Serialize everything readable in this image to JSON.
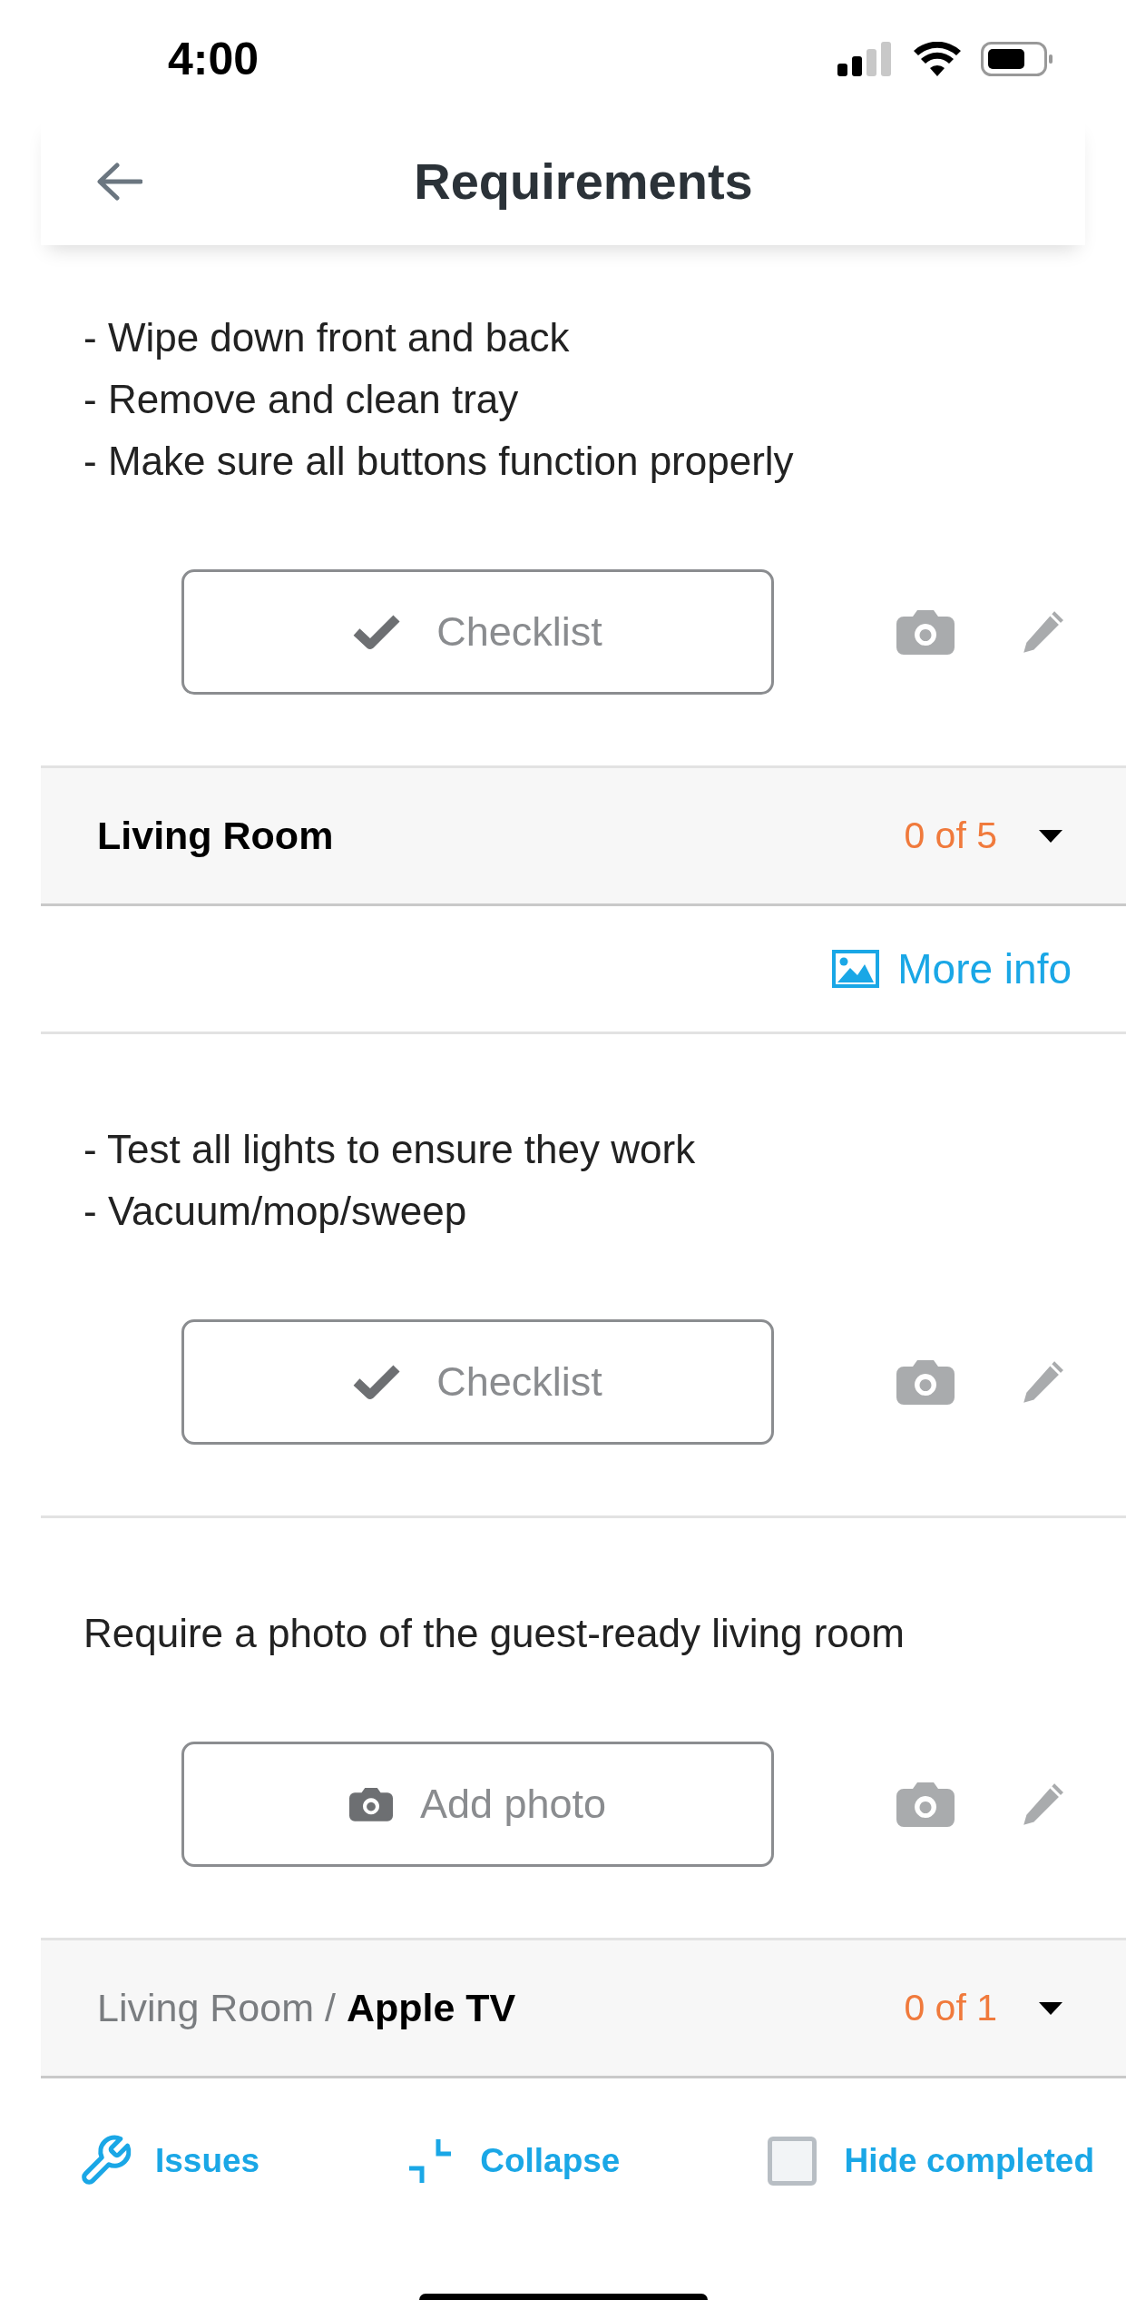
{
  "status_bar": {
    "time": "4:00"
  },
  "header": {
    "title": "Requirements"
  },
  "items": [
    {
      "kind": "task",
      "lines": [
        "- Wipe down front and back",
        "- Remove and clean tray",
        "- Make sure all buttons function properly"
      ],
      "action": {
        "kind": "checklist",
        "label": "Checklist"
      }
    },
    {
      "kind": "group",
      "title": "Living Room",
      "count": "0 of 5"
    },
    {
      "kind": "more_info",
      "label": "More info"
    },
    {
      "kind": "task",
      "lines": [
        "- Test all lights to ensure they work",
        "- Vacuum/mop/sweep"
      ],
      "action": {
        "kind": "checklist",
        "label": "Checklist"
      }
    },
    {
      "kind": "task",
      "lines": [
        "Require a photo of the guest-ready living room"
      ],
      "action": {
        "kind": "photo",
        "label": "Add photo"
      }
    },
    {
      "kind": "group",
      "parent": "Living Room /",
      "title": "Apple TV",
      "count": "0 of 1"
    }
  ],
  "bottom_bar": {
    "issues": "Issues",
    "collapse": "Collapse",
    "hide_completed": {
      "label": "Hide completed",
      "checked": false
    }
  }
}
